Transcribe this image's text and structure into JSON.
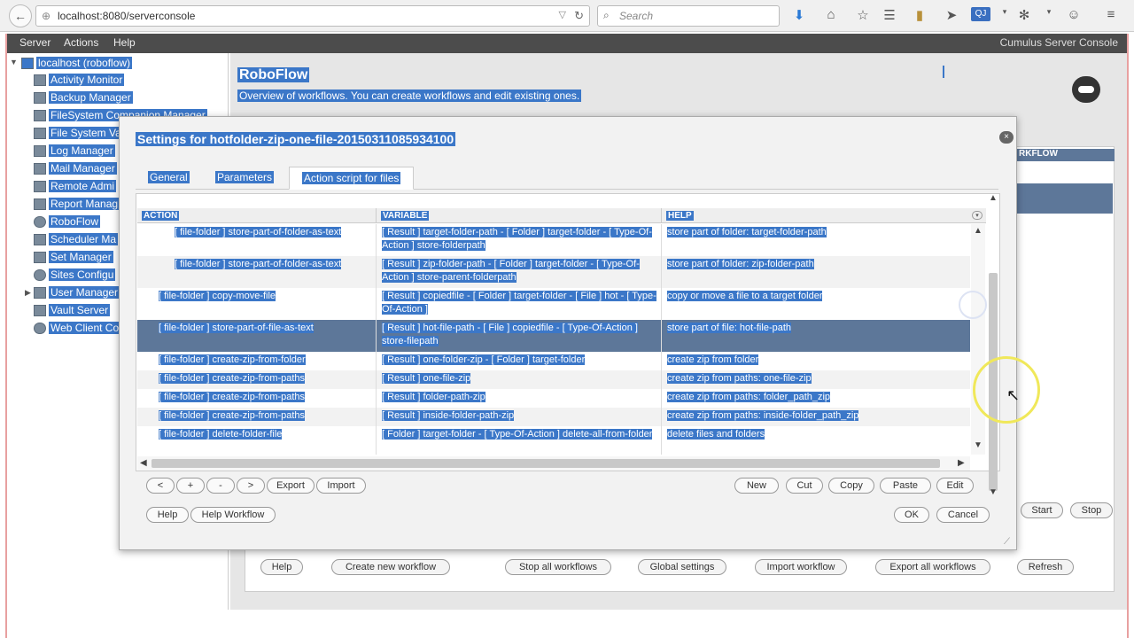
{
  "browser": {
    "url": "localhost:8080/serverconsole",
    "search_placeholder": "Search",
    "back_icon": "←"
  },
  "menubar": {
    "items": [
      "Server",
      "Actions",
      "Help"
    ],
    "app_title": "Cumulus Server Console"
  },
  "sidebar": {
    "root": "localhost (roboflow)",
    "items": [
      "Activity Monitor",
      "Backup Manager",
      "FileSystem Companion Manager",
      "File System Va",
      "Log Manager",
      "Mail Manager",
      "Remote Admi",
      "Report Manag",
      "RoboFlow",
      "Scheduler Ma",
      "Set Manager",
      "Sites Configu",
      "User Manager",
      "Vault Server",
      "Web Client Co"
    ]
  },
  "page": {
    "title": "RoboFlow",
    "subtitle": "Overview of workflows. You can create workflows and edit existing ones.",
    "bg_header": "RKFLOW",
    "bg_buttons": [
      "Help",
      "Create new workflow",
      "Stop all workflows",
      "Global settings",
      "Import workflow",
      "Export all workflows",
      "Refresh"
    ],
    "start_label": "Start",
    "stop_label": "Stop"
  },
  "modal": {
    "title": "Settings for hotfolder-zip-one-file-20150311085934100",
    "close": "×",
    "tabs": [
      "General",
      "Parameters",
      "Action script for files"
    ],
    "columns": [
      "ACTION",
      "VARIABLE",
      "HELP"
    ],
    "rows": [
      {
        "action": "[ file-folder ] store-part-of-folder-as-text",
        "variable": "[ Result ] target-folder-path - [ Folder ] target-folder - [ Type-Of-Action ] store-folderpath",
        "help": "store part of folder: target-folder-path"
      },
      {
        "action": "[ file-folder ] store-part-of-folder-as-text",
        "variable": "[ Result ] zip-folder-path - [ Folder ] target-folder - [ Type-Of-Action ] store-parent-folderpath",
        "help": "store part of folder: zip-folder-path"
      },
      {
        "action": "[ file-folder ] copy-move-file",
        "variable": "[ Result ] copiedfile - [ Folder ] target-folder - [ File ] hot - [ Type-Of-Action ]",
        "help": "copy or move a file to a target folder"
      },
      {
        "action": "[ file-folder ] store-part-of-file-as-text",
        "variable": "[ Result ] hot-file-path - [ File ] copiedfile - [ Type-Of-Action ] store-filepath",
        "help": "store part of file: hot-file-path"
      },
      {
        "action": "[ file-folder ] create-zip-from-folder",
        "variable": "[ Result ] one-folder-zip - [ Folder ] target-folder",
        "help": "create zip from folder"
      },
      {
        "action": "[ file-folder ] create-zip-from-paths",
        "variable": "[ Result ] one-file-zip",
        "help": "create zip from paths: one-file-zip"
      },
      {
        "action": "[ file-folder ] create-zip-from-paths",
        "variable": "[ Result ] folder-path-zip",
        "help": "create zip from paths: folder_path_zip"
      },
      {
        "action": "[ file-folder ] create-zip-from-paths",
        "variable": "[ Result ] inside-folder-path-zip",
        "help": "create zip from paths: inside-folder_path_zip"
      },
      {
        "action": "[ file-folder ] delete-folder-file",
        "variable": "[ Folder ] target-folder - [ Type-Of-Action ] delete-all-from-folder",
        "help": "delete files and folders"
      }
    ],
    "left_buttons": [
      "<",
      "+",
      "-",
      ">",
      "Export",
      "Import"
    ],
    "right_buttons": [
      "New",
      "Cut",
      "Copy",
      "Paste",
      "Edit"
    ],
    "bottom_left_buttons": [
      "Help",
      "Help Workflow"
    ],
    "ok": "OK",
    "cancel": "Cancel"
  }
}
